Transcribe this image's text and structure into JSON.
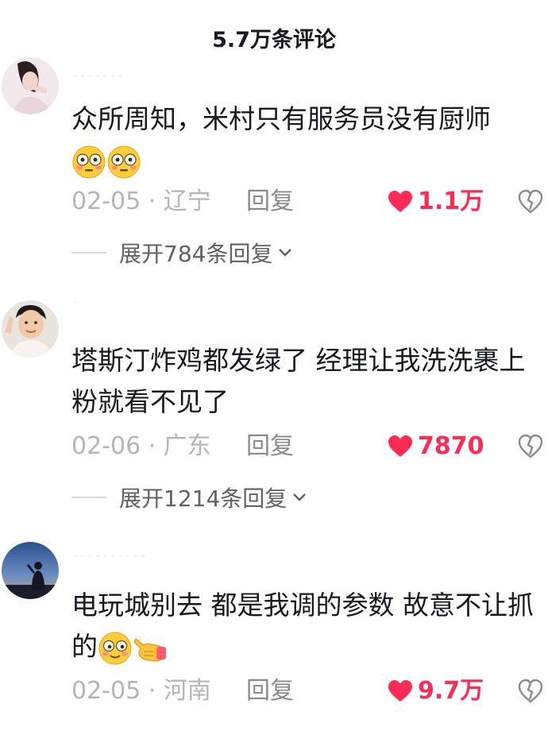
{
  "header": {
    "title": "5.7万条评论"
  },
  "comments": [
    {
      "username": "- - - - - - -",
      "text": "众所周知，米村只有服务员没有厨师",
      "emojis": [
        "flushed-emoji",
        "flushed-emoji"
      ],
      "date": "02-05 · 辽宁",
      "reply_label": "回复",
      "likes": "1.1万",
      "expand_label": "展开784条回复"
    },
    {
      "username": "-",
      "text": "塔斯汀炸鸡都发绿了 经理让我洗洗裹上粉就看不见了",
      "emojis": [],
      "date": "02-06 · 广东",
      "reply_label": "回复",
      "likes": "7870",
      "expand_label": "展开1214条回复"
    },
    {
      "username": "- - - - - - - - - -",
      "text": "电玩城别去 都是我调的参数 故意不让抓的",
      "emojis": [
        "blushing-emoji",
        "pointing-hand-emoji"
      ],
      "date": "02-05 · 河南",
      "reply_label": "回复",
      "likes": "9.7万",
      "expand_label": ""
    }
  ],
  "colors": {
    "like": "#fe2c55",
    "meta": "#b5b5b9",
    "text": "#161823"
  }
}
